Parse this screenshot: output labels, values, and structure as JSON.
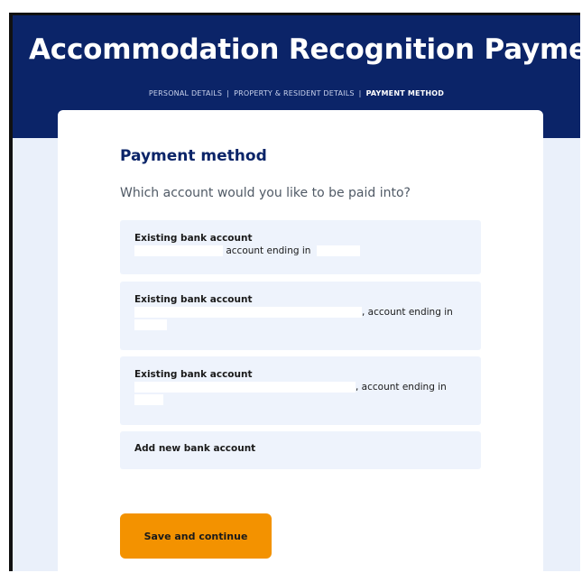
{
  "header": {
    "title": "Accommodation Recognition Payment",
    "steps": [
      {
        "label": "PERSONAL DETAILS",
        "active": false
      },
      {
        "label": "PROPERTY & RESIDENT DETAILS",
        "active": false
      },
      {
        "label": "PAYMENT METHOD",
        "active": true
      }
    ],
    "separator": "|"
  },
  "form": {
    "section_title": "Payment method",
    "question": "Which account would you like to be paid into?",
    "options": [
      {
        "title": "Existing bank account",
        "detail": "account ending in"
      },
      {
        "title": "Existing bank account",
        "detail": ", account ending in"
      },
      {
        "title": "Existing bank account",
        "detail": ", account ending in"
      },
      {
        "title": "Add new bank account"
      }
    ],
    "submit_label": "Save and continue"
  },
  "colors": {
    "header_bg": "#0b2468",
    "page_bg": "#eaf0fa",
    "option_bg": "#eef3fc",
    "primary_button": "#f39200",
    "heading": "#0b2468"
  }
}
